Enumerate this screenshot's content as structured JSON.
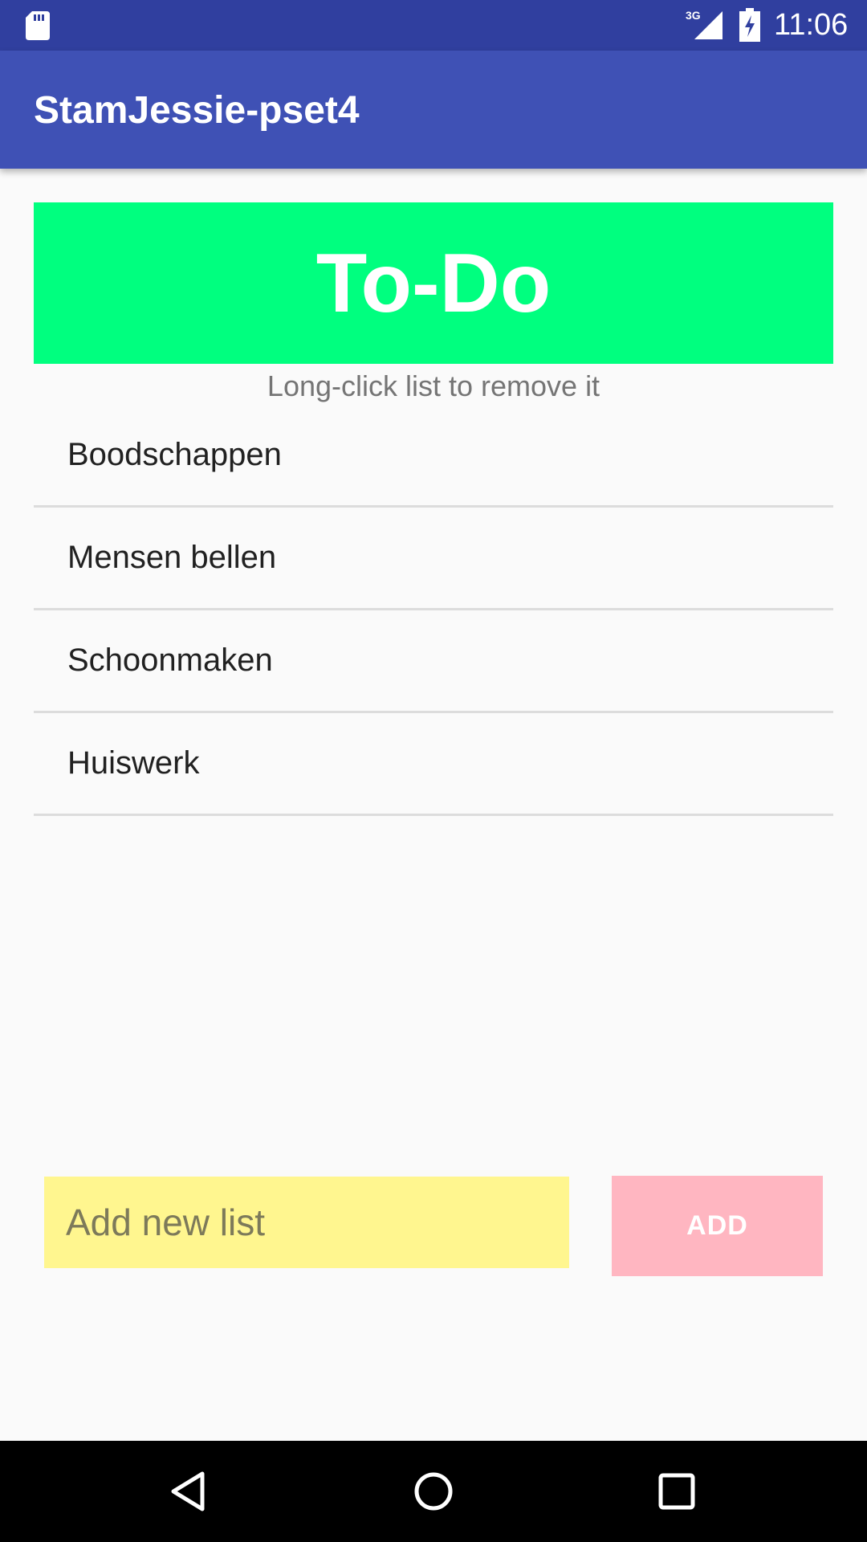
{
  "status_bar": {
    "time": "11:06",
    "network_type": "3G",
    "icons": [
      "sd-card-icon",
      "signal-icon",
      "battery-charging-icon"
    ]
  },
  "app_bar": {
    "title": "StamJessie-pset4"
  },
  "header": {
    "title": "To-Do"
  },
  "hint": "Long-click list to remove it",
  "lists": [
    {
      "label": "Boodschappen"
    },
    {
      "label": "Mensen bellen"
    },
    {
      "label": "Schoonmaken"
    },
    {
      "label": "Huiswerk"
    }
  ],
  "new_list": {
    "placeholder": "Add new list",
    "value": ""
  },
  "add_button": {
    "label": "ADD"
  },
  "nav_bar": {
    "icons": [
      "back-icon",
      "home-icon",
      "recents-icon"
    ]
  },
  "colors": {
    "status_bar": "#303f9f",
    "app_bar": "#3f51b5",
    "header_bg": "#00ff7f",
    "input_bg": "#fff68f",
    "add_button_bg": "#ffb6c1",
    "nav_bar": "#000000"
  }
}
